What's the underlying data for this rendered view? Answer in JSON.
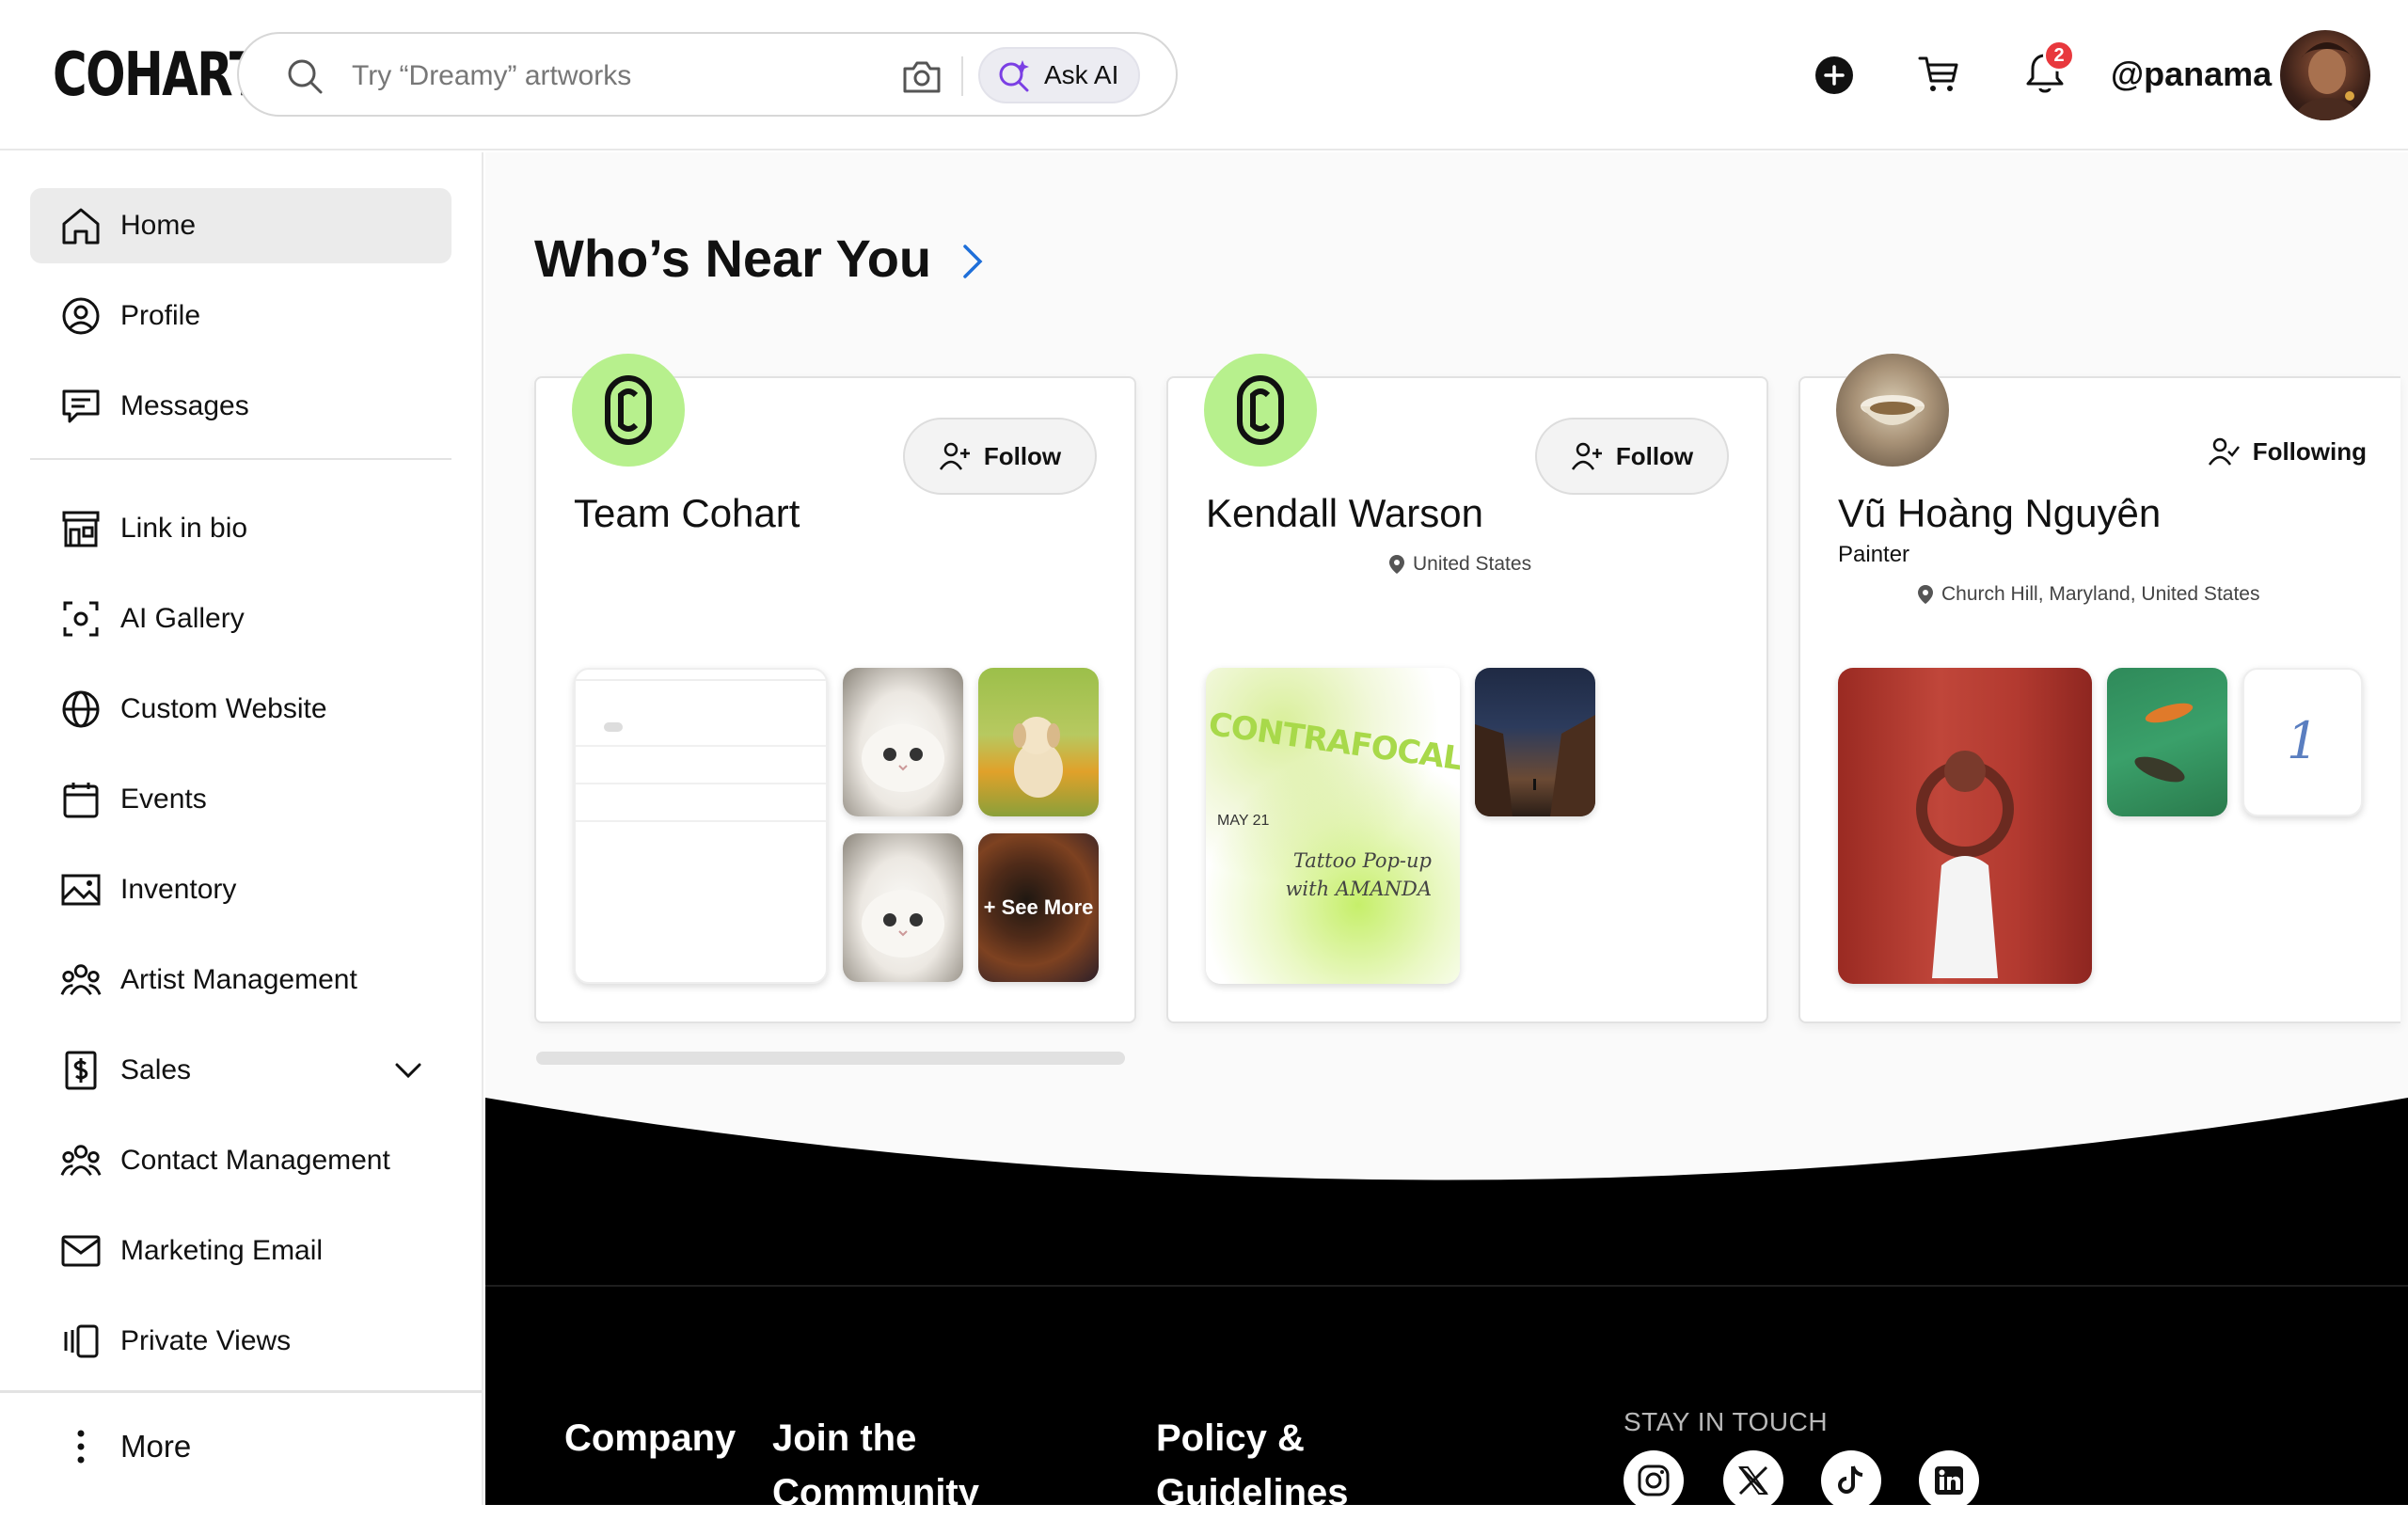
{
  "header": {
    "logo": "COHART",
    "search_placeholder": "Try “Dreamy” artworks",
    "ask_ai_label": "Ask AI",
    "notification_count": "2",
    "username": "@panama"
  },
  "sidebar": {
    "items": [
      {
        "label": "Home",
        "icon": "home-icon",
        "active": true
      },
      {
        "label": "Profile",
        "icon": "user-circle-icon"
      },
      {
        "label": "Messages",
        "icon": "message-icon"
      },
      {
        "label": "Link in bio",
        "icon": "storefront-icon"
      },
      {
        "label": "AI Gallery",
        "icon": "scan-face-icon"
      },
      {
        "label": "Custom Website",
        "icon": "globe-icon"
      },
      {
        "label": "Events",
        "icon": "calendar-icon"
      },
      {
        "label": "Inventory",
        "icon": "image-icon"
      },
      {
        "label": "Artist Management",
        "icon": "group-icon"
      },
      {
        "label": "Sales",
        "icon": "dollar-doc-icon"
      },
      {
        "label": "Contact Management",
        "icon": "group-icon"
      },
      {
        "label": "Marketing Email",
        "icon": "mail-icon"
      },
      {
        "label": "Private Views",
        "icon": "private-views-icon"
      }
    ],
    "more_label": "More"
  },
  "main": {
    "section_title": "Who’s Near You",
    "cards": [
      {
        "name": "Team Cohart",
        "follow_label": "Follow",
        "see_more_label": "+ See More"
      },
      {
        "name": "Kendall Warson",
        "location": "United States",
        "follow_label": "Follow",
        "event_title": "CONTRAFOCAL",
        "event_date": "MAY 21",
        "event_text": "Tattoo Pop-up with AMANDA"
      },
      {
        "name": "Vũ Hoàng Nguyên",
        "subtitle": "Painter",
        "location": "Church Hill, Maryland, United States",
        "following_label": "Following",
        "art_number": "1"
      }
    ]
  },
  "footer": {
    "columns": [
      {
        "label": "Company"
      },
      {
        "label": "Join the Community"
      },
      {
        "label": "Policy & Guidelines"
      }
    ],
    "stay_in_touch": "STAY IN TOUCH",
    "social_icons": [
      "instagram-icon",
      "x-icon",
      "tiktok-icon",
      "linkedin-icon"
    ]
  },
  "colors": {
    "accent_green": "#b7f08d",
    "badge_red": "#e8383d",
    "link_blue": "#1e6fd9",
    "ai_purple": "#7b3fe4"
  }
}
